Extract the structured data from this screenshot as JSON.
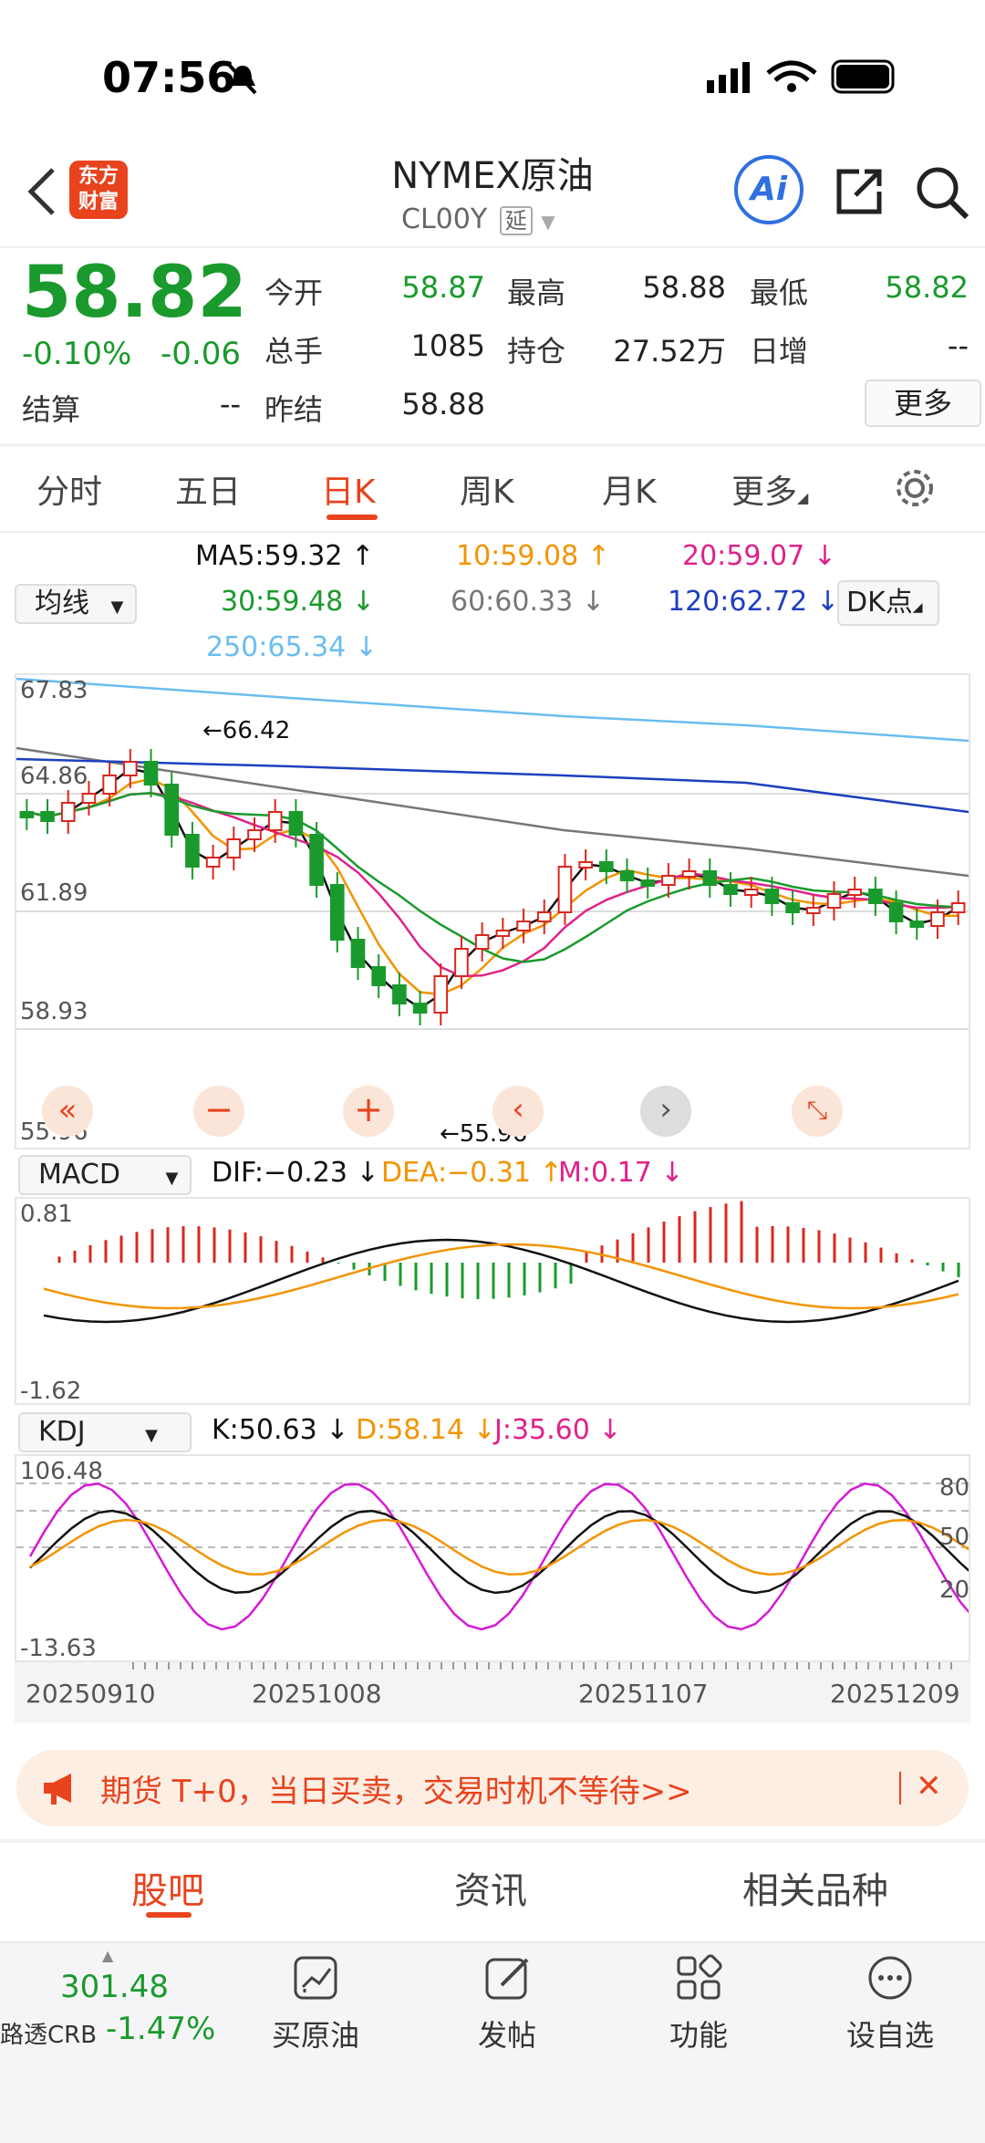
{
  "status": {
    "time": "07:56"
  },
  "header": {
    "logo_text_1": "东方",
    "logo_text_2": "财富",
    "title": "NYMEX原油",
    "code": "CL00Y",
    "delay_badge": "延",
    "ai_label": "Ai"
  },
  "quote": {
    "price": "58.82",
    "change_pct": "-0.10%",
    "change": "-0.06",
    "settle_label": "结算",
    "settle_value": "--",
    "fields": [
      {
        "label": "今开",
        "value": "58.87"
      },
      {
        "label": "最高",
        "value": "58.88"
      },
      {
        "label": "最低",
        "value": "58.82"
      },
      {
        "label": "总手",
        "value": "1085"
      },
      {
        "label": "持仓",
        "value": "27.52万"
      },
      {
        "label": "日增",
        "value": "--"
      },
      {
        "label": "昨结",
        "value": "58.88"
      }
    ],
    "more_label": "更多"
  },
  "tabs": [
    "分时",
    "五日",
    "日K",
    "周K",
    "月K",
    "更多"
  ],
  "ma": {
    "selector": "均线",
    "ma5": "MA5:59.32",
    "ma10": "10:59.08",
    "ma20": "20:59.07",
    "ma30": "30:59.48",
    "ma60": "60:60.33",
    "ma120": "120:62.72",
    "ma250": "250:65.34",
    "dk": "DK点",
    "arrows": {
      "up": "↑",
      "down": "↓"
    }
  },
  "kline": {
    "y_ticks": [
      "67.83",
      "64.86",
      "61.89",
      "58.93",
      "55.96"
    ],
    "high_label": "66.42",
    "low_label": "55.96"
  },
  "macd": {
    "selector": "MACD",
    "dif": "DIF:−0.23",
    "dea": "DEA:−0.31",
    "m": "M:0.17",
    "y_top": "0.81",
    "y_bottom": "-1.62"
  },
  "kdj": {
    "selector": "KDJ",
    "k": "K:50.63",
    "d": "D:58.14",
    "j": "J:35.60",
    "y_top": "106.48",
    "y_bottom": "-13.63",
    "levels": [
      "80",
      "50",
      "20"
    ]
  },
  "x_axis": [
    "20250910",
    "20251008",
    "20251107",
    "20251209"
  ],
  "banner": {
    "text": "期货 T+0，当日买卖，交易时机不等待>>"
  },
  "bottom_tabs": [
    "股吧",
    "资讯",
    "相关品种"
  ],
  "toolbar": {
    "crb_value": "301.48",
    "crb_label": "路透CRB",
    "crb_change": "-1.47%",
    "items": [
      "买原油",
      "发帖",
      "功能",
      "设自选"
    ]
  },
  "colors": {
    "accent": "#e8431d",
    "up": "#d9281f",
    "down": "#1a9a2c",
    "ma5": "#111111",
    "ma10": "#f39400",
    "ma20": "#e0218a",
    "ma30": "#1a9a2c",
    "ma60": "#777777",
    "ma120": "#1d3fbf",
    "ma250": "#6bbdf0"
  }
}
